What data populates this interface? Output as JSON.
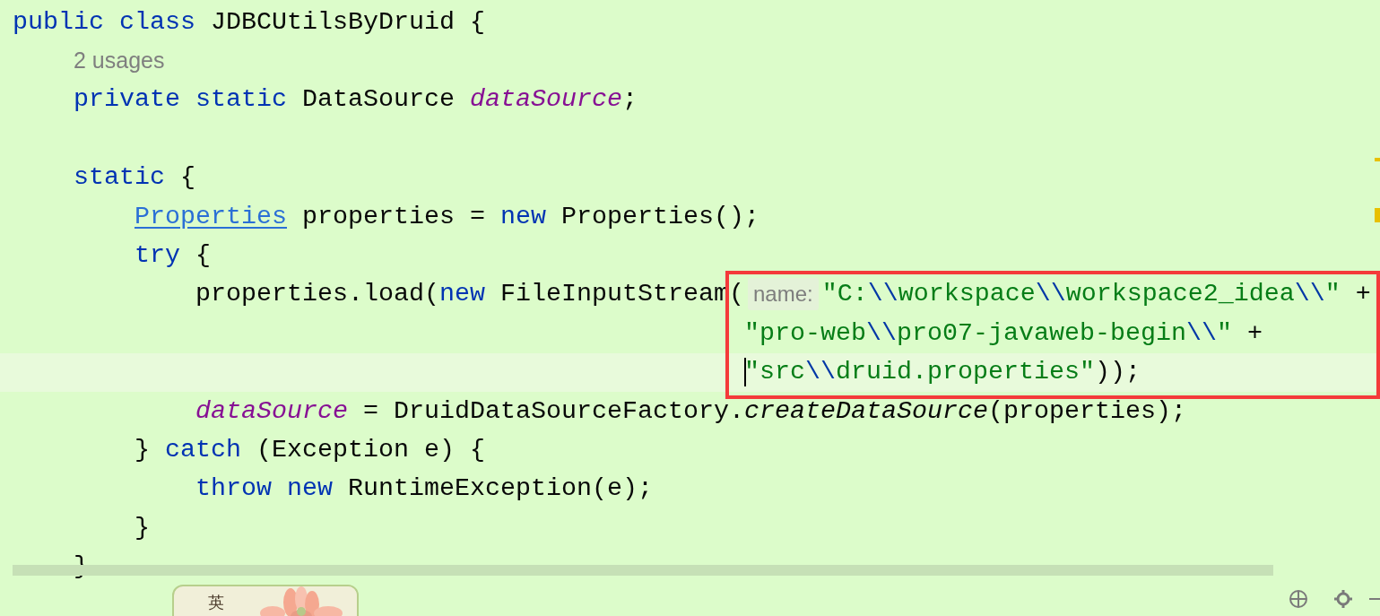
{
  "lines": [
    {
      "kind": "code",
      "tokens": [
        {
          "kind": "keyword",
          "text": "public "
        },
        {
          "kind": "keyword",
          "text": "class"
        },
        {
          "kind": "plain",
          "text": " JDBCUtilsByDruid {"
        }
      ]
    },
    {
      "kind": "usages",
      "text": "2 usages"
    },
    {
      "kind": "code",
      "tokens": [
        {
          "kind": "keyword",
          "text": "    private "
        },
        {
          "kind": "keyword",
          "text": "static"
        },
        {
          "kind": "plain",
          "text": " DataSource "
        },
        {
          "kind": "field",
          "text": "dataSource"
        },
        {
          "kind": "plain",
          "text": ";"
        }
      ]
    },
    {
      "kind": "blank"
    },
    {
      "kind": "code",
      "tokens": [
        {
          "kind": "keyword",
          "text": "    static"
        },
        {
          "kind": "plain",
          "text": " {"
        }
      ]
    },
    {
      "kind": "code",
      "tokens": [
        {
          "kind": "link",
          "text": "        Properties"
        },
        {
          "kind": "plain",
          "text": " properties = "
        },
        {
          "kind": "keyword",
          "text": "new"
        },
        {
          "kind": "plain",
          "text": " Properties();"
        }
      ]
    },
    {
      "kind": "code",
      "tokens": [
        {
          "kind": "keyword",
          "text": "        try"
        },
        {
          "kind": "plain",
          "text": " {"
        }
      ]
    },
    {
      "kind": "code",
      "tokens": [
        {
          "kind": "plain",
          "text": "            properties.load("
        },
        {
          "kind": "keyword",
          "text": "new"
        },
        {
          "kind": "plain",
          "text": " FileInputStream("
        },
        {
          "kind": "inlay",
          "text": "name:"
        },
        {
          "kind": "string",
          "text": "\"C:"
        },
        {
          "kind": "escape",
          "text": "\\\\"
        },
        {
          "kind": "string",
          "text": "workspace"
        },
        {
          "kind": "escape",
          "text": "\\\\"
        },
        {
          "kind": "string",
          "text": "workspace2_idea"
        },
        {
          "kind": "escape",
          "text": "\\\\"
        },
        {
          "kind": "string",
          "text": "\""
        },
        {
          "kind": "plain",
          "text": " +"
        }
      ]
    },
    {
      "kind": "code",
      "tokens": [
        {
          "kind": "string",
          "text": "                                                \"pro-web"
        },
        {
          "kind": "escape",
          "text": "\\\\"
        },
        {
          "kind": "string",
          "text": "pro07-javaweb-begin"
        },
        {
          "kind": "escape",
          "text": "\\\\"
        },
        {
          "kind": "string",
          "text": "\""
        },
        {
          "kind": "plain",
          "text": " +"
        }
      ]
    },
    {
      "kind": "code",
      "caret": true,
      "tokens": [
        {
          "kind": "string",
          "text": "                                                \"src"
        },
        {
          "kind": "escape",
          "text": "\\\\"
        },
        {
          "kind": "string",
          "text": "druid.properties\""
        },
        {
          "kind": "plain",
          "text": "));"
        }
      ]
    },
    {
      "kind": "code",
      "tokens": [
        {
          "kind": "field",
          "text": "            dataSource"
        },
        {
          "kind": "plain",
          "text": " = DruidDataSourceFactory."
        },
        {
          "kind": "method",
          "text": "createDataSource"
        },
        {
          "kind": "plain",
          "text": "(properties);"
        }
      ]
    },
    {
      "kind": "code",
      "tokens": [
        {
          "kind": "plain",
          "text": "        } "
        },
        {
          "kind": "keyword",
          "text": "catch"
        },
        {
          "kind": "plain",
          "text": " (Exception e) {"
        }
      ]
    },
    {
      "kind": "code",
      "tokens": [
        {
          "kind": "keyword",
          "text": "            throw "
        },
        {
          "kind": "keyword",
          "text": "new"
        },
        {
          "kind": "plain",
          "text": " RuntimeException(e);"
        }
      ]
    },
    {
      "kind": "code",
      "tokens": [
        {
          "kind": "plain",
          "text": "        }"
        }
      ]
    },
    {
      "kind": "code",
      "tokens": [
        {
          "kind": "plain",
          "text": "    }"
        }
      ]
    }
  ],
  "ime_toolbar": {
    "mode": "英"
  }
}
